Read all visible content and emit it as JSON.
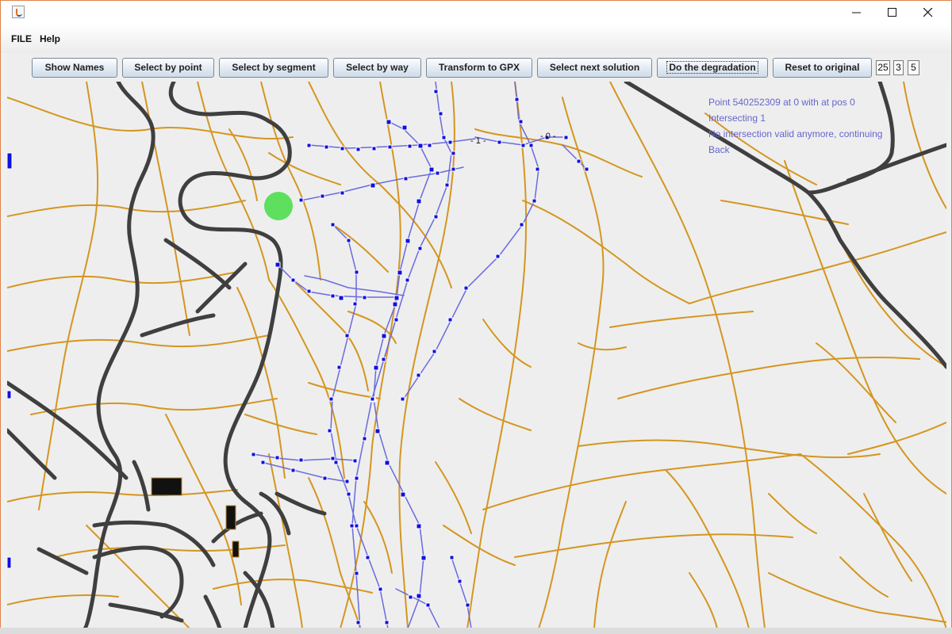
{
  "window": {
    "icon": "java-coffee-icon",
    "controls": [
      "minimize-icon",
      "maximize-icon",
      "close-icon"
    ]
  },
  "menu": {
    "file": "FILE",
    "help": "Help"
  },
  "toolbar": {
    "show_names": "Show Names",
    "select_by_point": "Select by point",
    "select_by_segment": "Select by segment",
    "select_by_way": "Select by way",
    "transform_to_gpx": "Transform to GPX",
    "select_next_solution": "Select next solution",
    "do_the_degradation": "Do the degradation",
    "reset_to_original": "Reset to original",
    "field_1": "25",
    "field_2": "3",
    "field_3": "5"
  },
  "log": {
    "line1": "Point 540252309 at 0 with at pos 0",
    "line2": "Intersecting 1",
    "line3": "No intersection valid anymore, continuing",
    "line4": "Back"
  },
  "map": {
    "marker_labels": [
      "- 1 -",
      "- 0 -"
    ],
    "colors": {
      "minor_road": "#d4961f",
      "major_road": "#3f3f3f",
      "gpx_track": "#1010e0",
      "gpx_line": "#6a6adf",
      "selection": "#44dd44",
      "building": "#111111"
    }
  }
}
